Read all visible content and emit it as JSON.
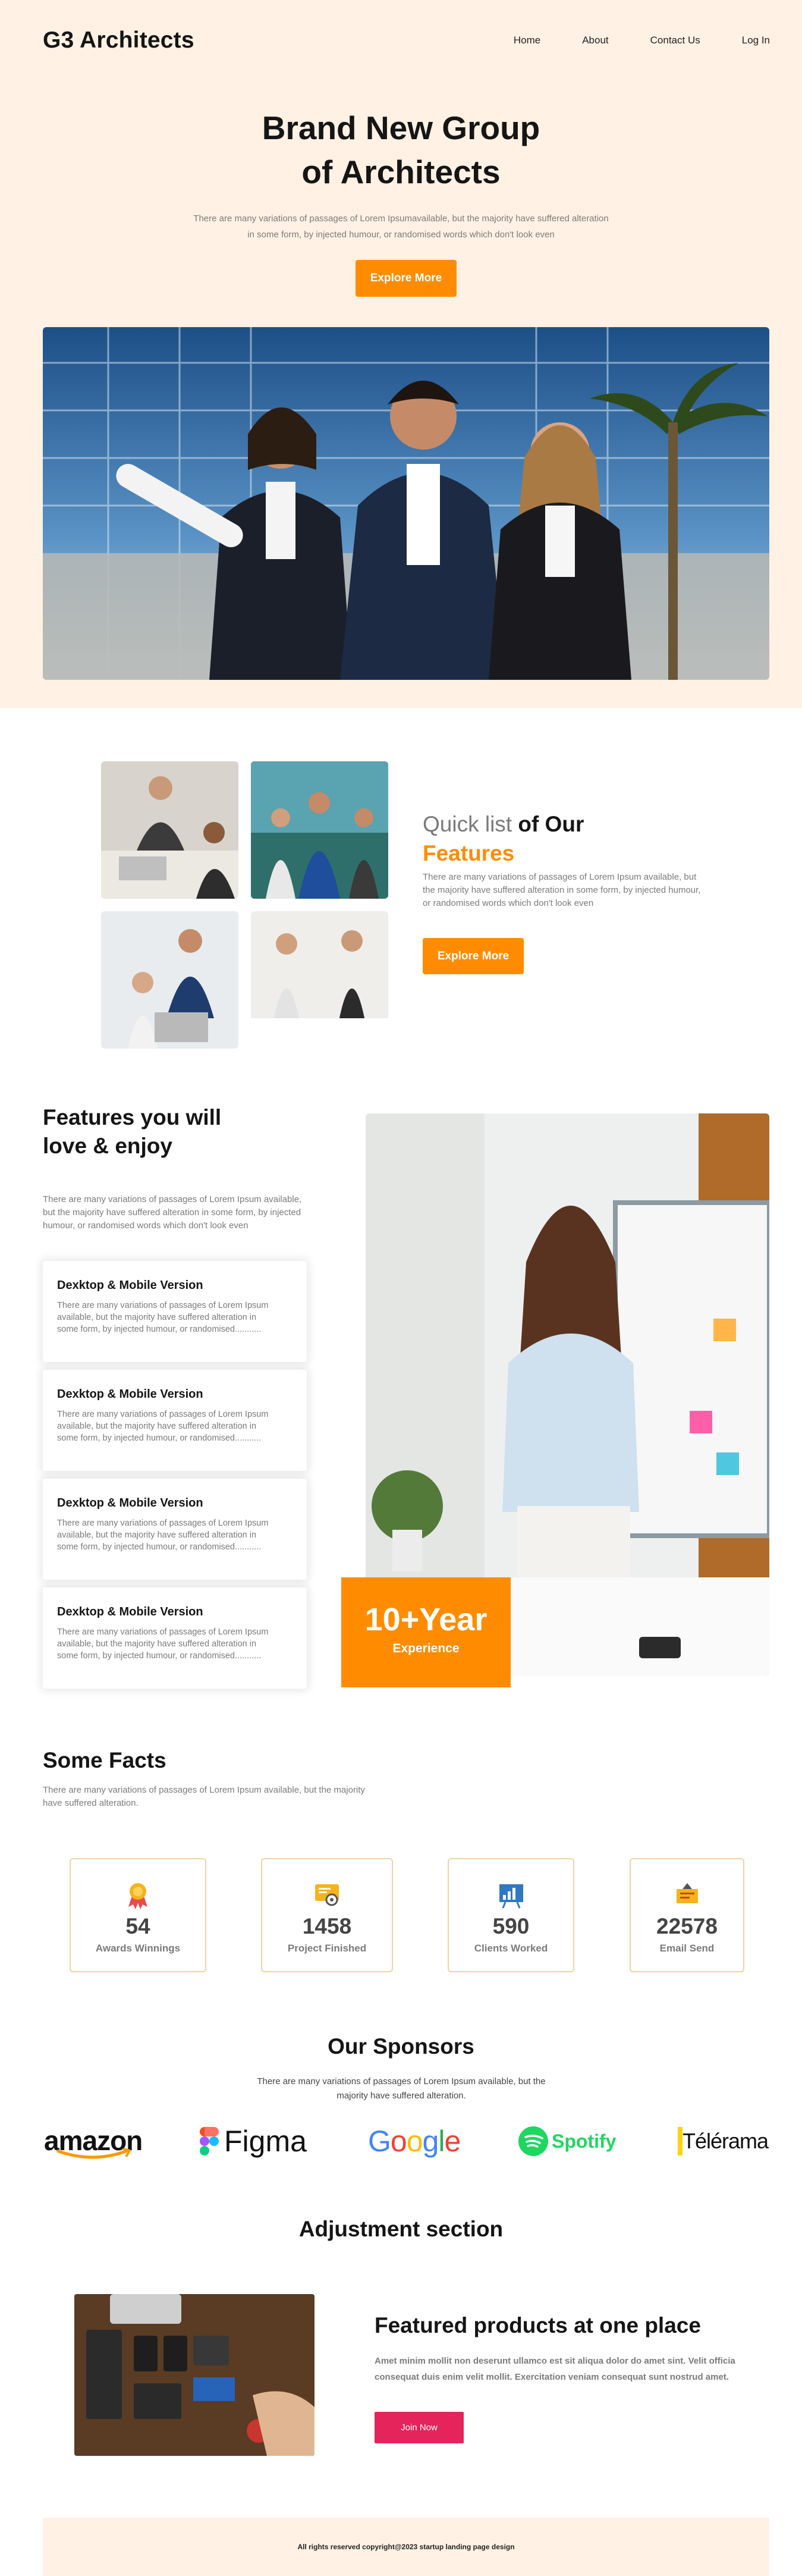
{
  "header": {
    "logo": "G3 Architects",
    "nav": [
      "Home",
      "About",
      "Contact Us",
      "Log In"
    ]
  },
  "hero": {
    "title_line1": "Brand New Group",
    "title_line2": "of Architects",
    "subtitle": "There are many variations of passages of Lorem Ipsumavailable, but the majority have suffered alteration in some form, by injected humour, or randomised words which don't look even",
    "button": "Explore More"
  },
  "quick_list": {
    "title_light": "Quick list",
    "title_bold": " of Our",
    "title_accent": "Features",
    "subtitle": "There are many variations of passages of Lorem Ipsum available, but the majority have suffered alteration in some form, by injected humour, or randomised words which don't look even",
    "button": "Explore More"
  },
  "features": {
    "title": "Features you will love & enjoy",
    "subtitle": "There are many variations of passages of Lorem Ipsum available, but the majority have suffered alteration in some form, by injected humour, or randomised words which don't look even",
    "cards": [
      {
        "title": "Dexktop & Mobile Version",
        "text": "There are many variations of passages of Lorem Ipsum available, but the majority have suffered alteration in some form, by injected humour, or randomised..........."
      },
      {
        "title": "Dexktop & Mobile Version",
        "text": "There are many variations of passages of Lorem Ipsum available, but the majority have suffered alteration in some form, by injected humour, or randomised..........."
      },
      {
        "title": "Dexktop & Mobile Version",
        "text": "There are many variations of passages of Lorem Ipsum available, but the majority have suffered alteration in some form, by injected humour, or randomised..........."
      },
      {
        "title": "Dexktop & Mobile Version",
        "text": "There are many variations of passages of Lorem Ipsum available, but the majority have suffered alteration in some form, by injected humour, or randomised..........."
      }
    ],
    "experience_value": "10+Year",
    "experience_label": "Experience"
  },
  "facts": {
    "title": "Some Facts",
    "subtitle": "There are many variations of passages of Lorem Ipsum available, but the majority have suffered alteration.",
    "items": [
      {
        "value": "54",
        "label": "Awards Winnings",
        "icon": "award-ribbon-icon"
      },
      {
        "value": "1458",
        "label": "Project Finished",
        "icon": "certificate-icon"
      },
      {
        "value": "590",
        "label": "Clients Worked",
        "icon": "analytics-board-icon"
      },
      {
        "value": "22578",
        "label": "Email Send",
        "icon": "mail-sign-icon"
      }
    ]
  },
  "sponsors": {
    "title": "Our Sponsors",
    "subtitle": "There are many variations of passages of Lorem Ipsum available, but the majority have suffered alteration.",
    "logos": [
      "amazon",
      "Figma",
      "Google",
      "Spotify",
      "Télérama"
    ]
  },
  "adjustment": {
    "title": "Adjustment section",
    "heading": "Featured products at one place",
    "text": "Amet minim mollit non deserunt ullamco est sit aliqua dolor do amet sint. Velit officia consequat duis enim velit mollit. Exercitation veniam consequat sunt nostrud amet.",
    "button": "Join Now"
  },
  "footer": {
    "text": "All rights reserved copyright@2023 startup landing page design"
  },
  "colors": {
    "accent": "#ff8c00",
    "hero_bg": "#fff1e3",
    "join_button": "#e5245c"
  }
}
